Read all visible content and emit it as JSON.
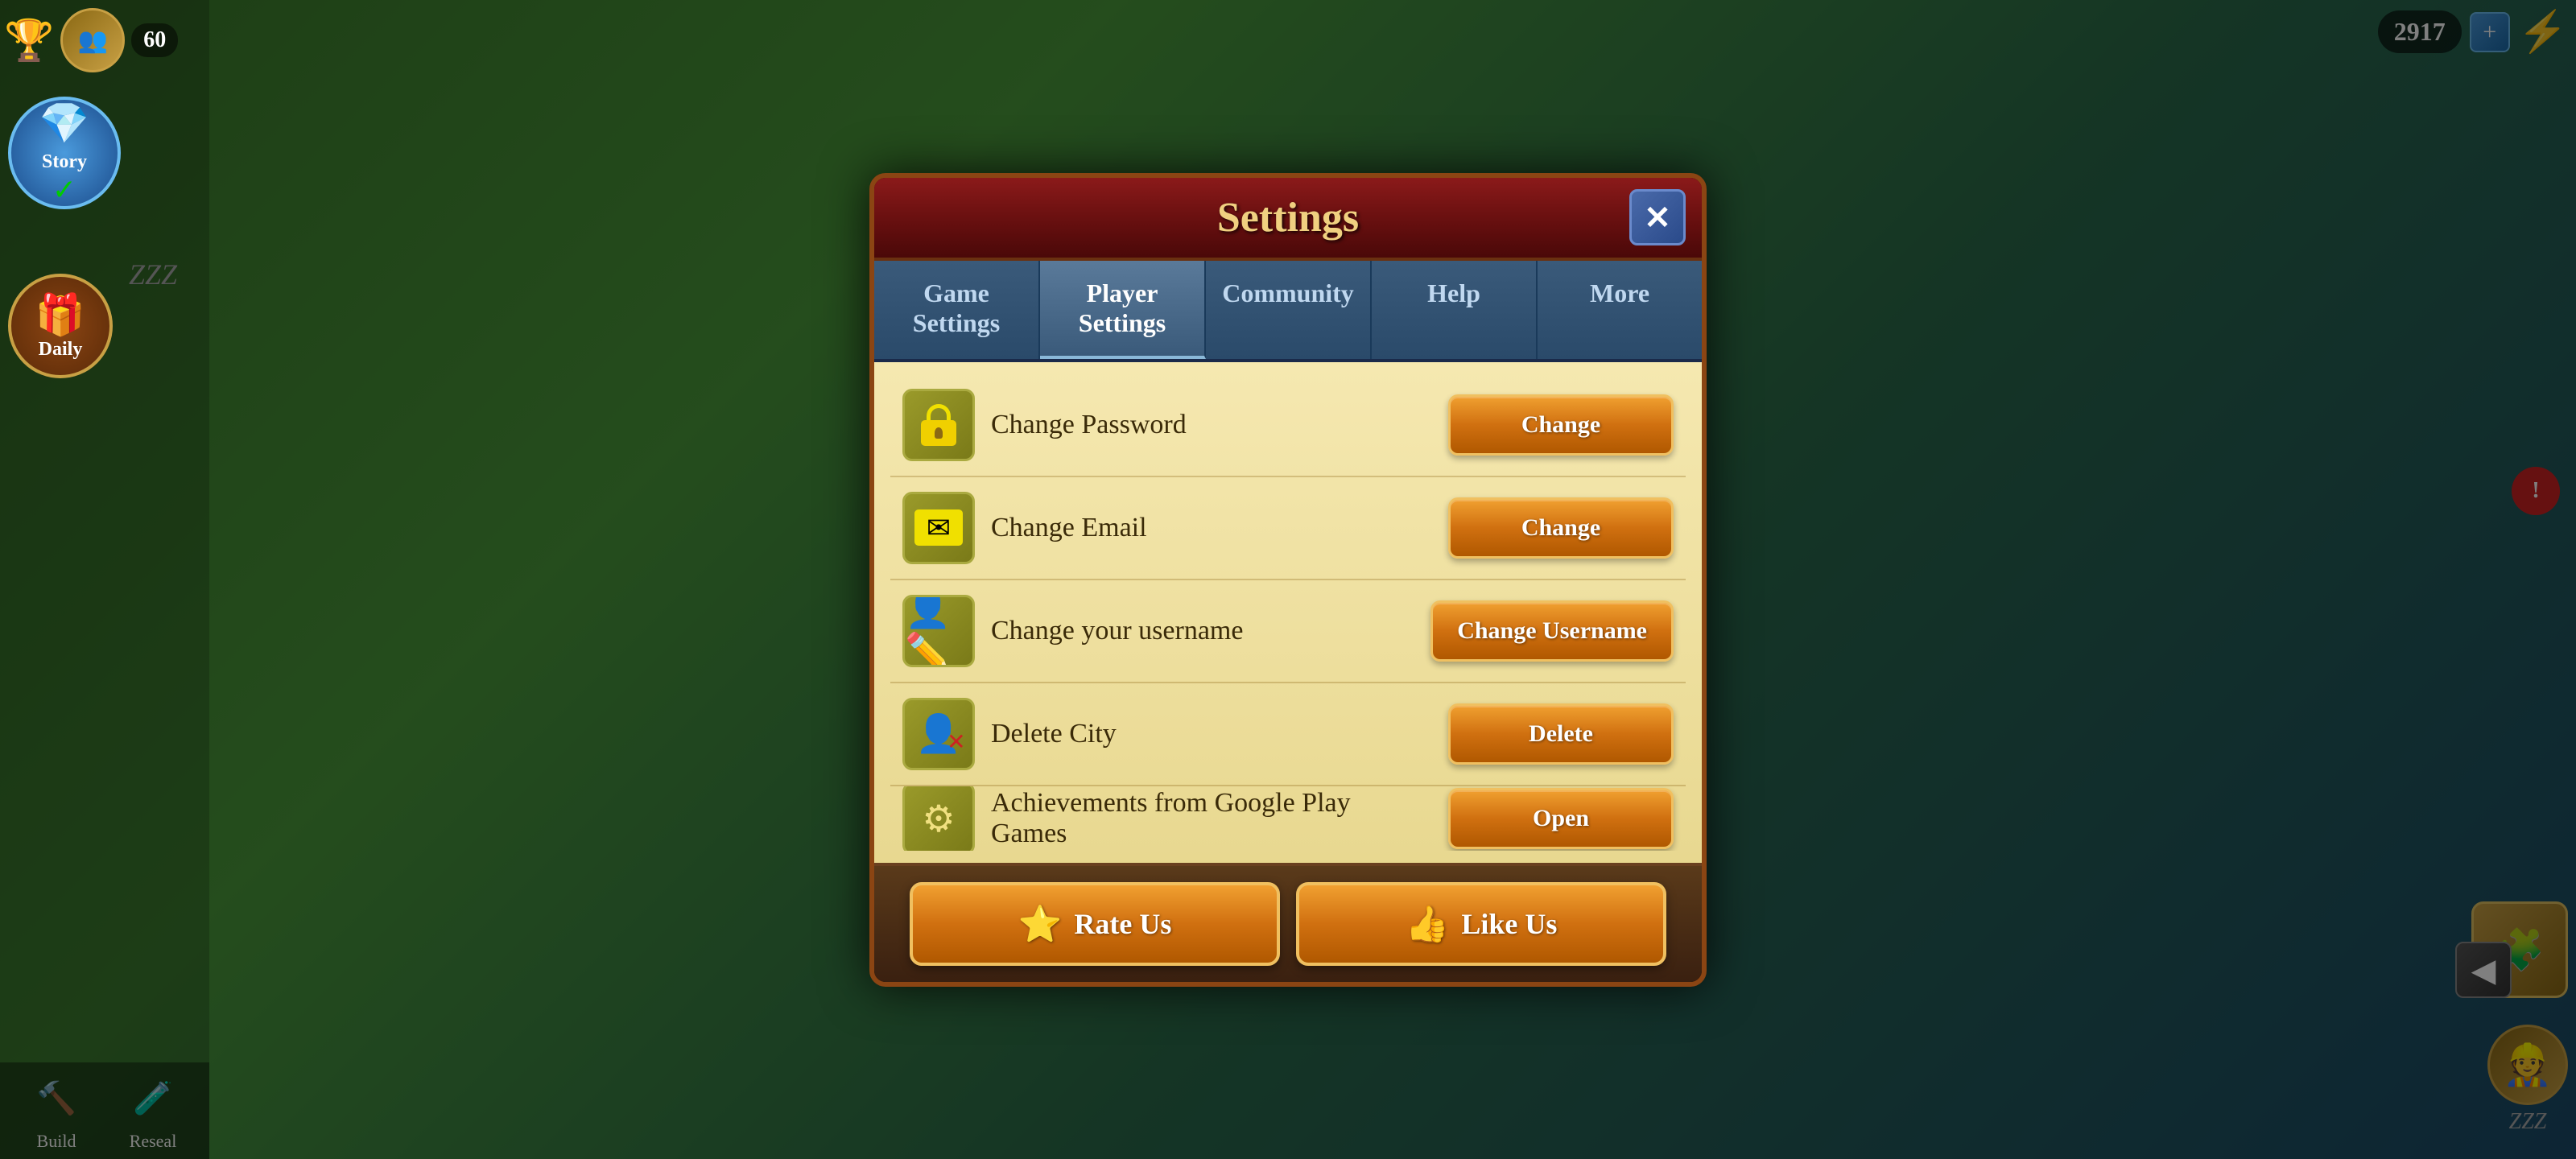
{
  "game": {
    "currency": "60",
    "gems": "2917",
    "bg_color": "#3a7a2a"
  },
  "modal": {
    "title": "Settings",
    "close_label": "✕"
  },
  "tabs": [
    {
      "id": "game",
      "label": "Game Settings",
      "active": false
    },
    {
      "id": "player",
      "label": "Player Settings",
      "active": true
    },
    {
      "id": "community",
      "label": "Community",
      "active": false
    },
    {
      "id": "help",
      "label": "Help",
      "active": false
    },
    {
      "id": "more",
      "label": "More",
      "active": false
    }
  ],
  "settings_rows": [
    {
      "id": "change-password",
      "icon": "🔒",
      "icon_type": "lock",
      "label": "Change Password",
      "button_label": "Change"
    },
    {
      "id": "change-email",
      "icon": "✉",
      "icon_type": "email",
      "label": "Change Email",
      "button_label": "Change"
    },
    {
      "id": "change-username",
      "icon": "👤",
      "icon_type": "user",
      "label": "Change your username",
      "button_label": "Change Username"
    },
    {
      "id": "delete-city",
      "icon": "🗑",
      "icon_type": "delete",
      "label": "Delete City",
      "button_label": "Delete"
    },
    {
      "id": "achievements",
      "icon": "⚙",
      "icon_type": "achievements",
      "label": "Achievements from Google Play Games",
      "button_label": "Open"
    }
  ],
  "footer_buttons": [
    {
      "id": "rate-us",
      "label": "Rate Us",
      "icon": "⭐"
    },
    {
      "id": "like-us",
      "label": "Like Us",
      "icon": "👍"
    }
  ],
  "left_nav": {
    "story_label": "Story",
    "daily_label": "Daily",
    "build_label": "Build",
    "research_label": "Reseal"
  },
  "right_nav": {
    "notification_count": "!"
  }
}
